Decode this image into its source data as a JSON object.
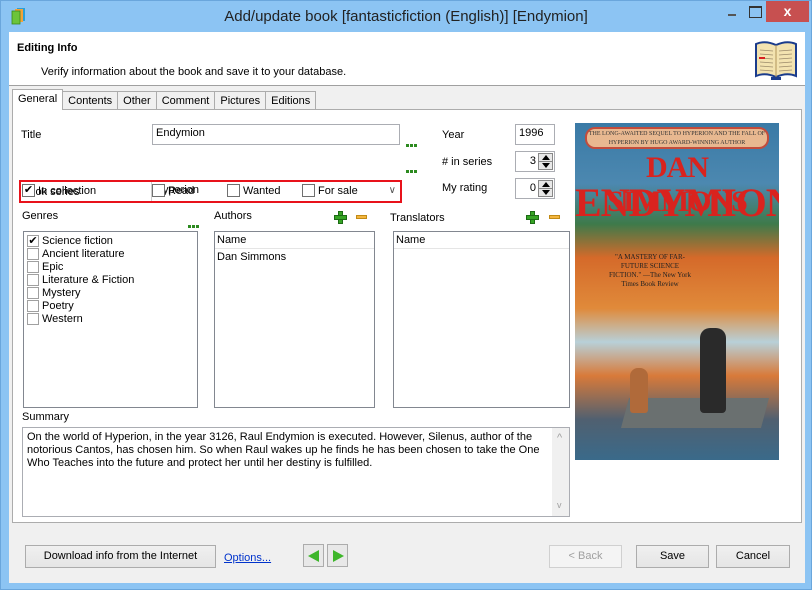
{
  "window": {
    "title": "Add/update book [fantasticfiction (English)] [Endymion]",
    "close_label": "x"
  },
  "header": {
    "title": "Editing Info",
    "subtitle": "Verify information about the book and save it to your database."
  },
  "tabs": [
    {
      "label": "General",
      "active": true
    },
    {
      "label": "Contents"
    },
    {
      "label": "Other"
    },
    {
      "label": "Comment"
    },
    {
      "label": "Pictures"
    },
    {
      "label": "Editions"
    }
  ],
  "general": {
    "title_label": "Title",
    "title_value": "Endymion",
    "series_label": "Book series",
    "series_value": "Hyperion",
    "year_label": "Year",
    "year_value": "1996",
    "in_series_label": "# in series",
    "in_series_value": "3",
    "rating_label": "My rating",
    "rating_value": "0",
    "checkboxes": [
      {
        "label": "In collection",
        "checked": true,
        "mark": "✔"
      },
      {
        "label": "Read",
        "checked": false,
        "mark": ""
      },
      {
        "label": "Wanted",
        "checked": false,
        "mark": ""
      },
      {
        "label": "For sale",
        "checked": false,
        "mark": ""
      }
    ],
    "genres_label": "Genres",
    "genres": [
      {
        "label": "Science fiction",
        "checked": true,
        "mark": "✔"
      },
      {
        "label": "Ancient literature",
        "checked": false,
        "mark": ""
      },
      {
        "label": "Epic",
        "checked": false,
        "mark": ""
      },
      {
        "label": "Literature & Fiction",
        "checked": false,
        "mark": ""
      },
      {
        "label": "Mystery",
        "checked": false,
        "mark": ""
      },
      {
        "label": "Poetry",
        "checked": false,
        "mark": ""
      },
      {
        "label": "Western",
        "checked": false,
        "mark": ""
      }
    ],
    "authors_label": "Authors",
    "authors_column": "Name",
    "authors": [
      "Dan Simmons"
    ],
    "translators_label": "Translators",
    "translators_column": "Name",
    "summary_label": "Summary",
    "summary": "On the world of Hyperion, in the year 3126, Raul Endymion is executed. However, Silenus, author of the notorious Cantos, has chosen him. So when Raul wakes up he finds he has been chosen to take the One Who Teaches into the future and protect her until her destiny is fulfilled."
  },
  "cover": {
    "banner": "THE LONG-AWAITED SEQUEL TO HYPERION AND THE FALL OF HYPERION BY HUGO AWARD-WINNING AUTHOR",
    "author": "DAN SIMMONS",
    "title": "ENDYMION",
    "quote": "\"A MASTERY OF FAR-FUTURE SCIENCE FICTION.\" —The New York Times Book Review"
  },
  "footer": {
    "download_label": "Download info from the Internet",
    "options_label": "Options...",
    "back_label": "< Back",
    "save_label": "Save",
    "cancel_label": "Cancel"
  }
}
